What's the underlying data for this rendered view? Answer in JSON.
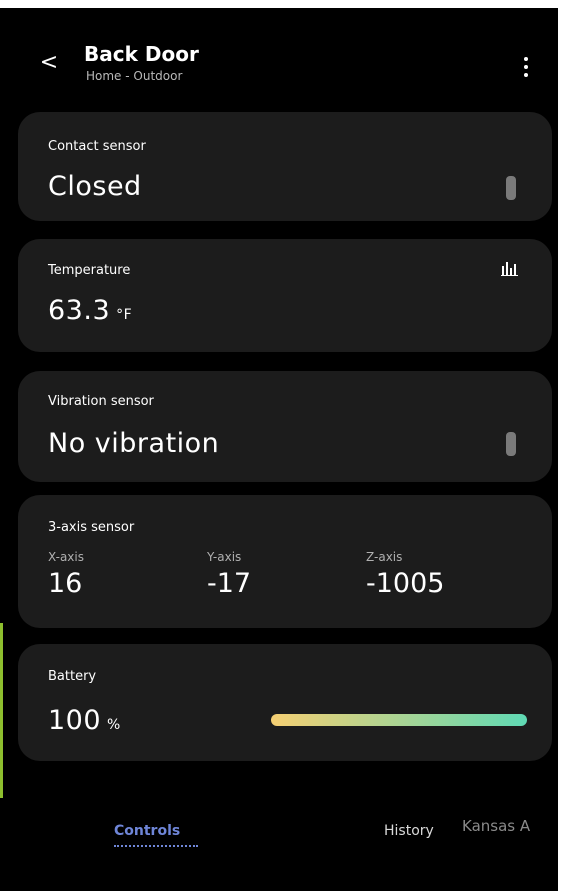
{
  "header": {
    "back_glyph": "<",
    "title": "Back Door",
    "subtitle": "Home - Outdoor",
    "more_icon": "more-vertical-icon"
  },
  "cards": {
    "contact": {
      "label": "Contact sensor",
      "value": "Closed"
    },
    "temperature": {
      "label": "Temperature",
      "value": "63.3",
      "unit": "°F",
      "icon": "bar-chart-icon"
    },
    "vibration": {
      "label": "Vibration sensor",
      "value": "No vibration"
    },
    "three_axis": {
      "label": "3-axis sensor",
      "axes": [
        {
          "label": "X-axis",
          "value": "16"
        },
        {
          "label": "Y-axis",
          "value": "-17"
        },
        {
          "label": "Z-axis",
          "value": "-1005"
        }
      ]
    },
    "battery": {
      "label": "Battery",
      "value": "100",
      "unit": "%",
      "level": 1.0,
      "gradient_start": "#f5cf73",
      "gradient_end": "#5fd9b4"
    }
  },
  "tabs": [
    {
      "label": "Controls",
      "active": true
    },
    {
      "label": "History",
      "active": false
    }
  ],
  "watermark": "Kansas A",
  "colors": {
    "background": "#000000",
    "card": "#1c1c1c",
    "accent": "#6f86d8",
    "toggle": "#7a7a7a"
  }
}
